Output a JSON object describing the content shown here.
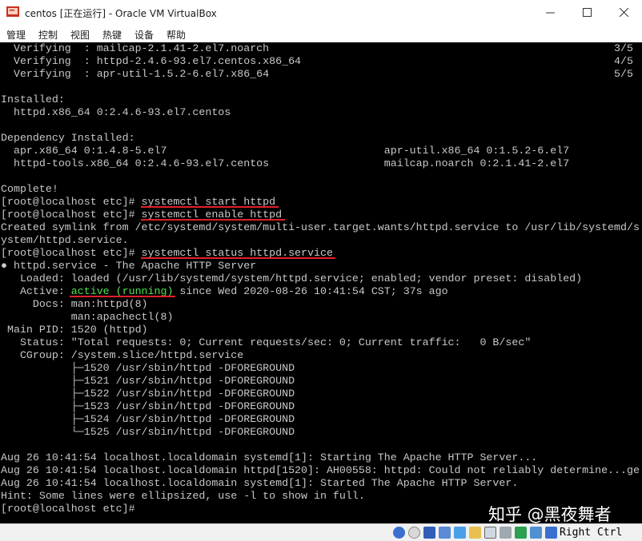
{
  "window": {
    "title": "centos [正在运行] - Oracle VM VirtualBox",
    "minimize_glyph": "—",
    "maximize_glyph": "☐",
    "close_glyph": "✕"
  },
  "menu": [
    "管理",
    "控制",
    "视图",
    "热键",
    "设备",
    "帮助"
  ],
  "console": {
    "lines": [
      "  Verifying  : mailcap-2.1.41-2.el7.noarch",
      "  Verifying  : httpd-2.4.6-93.el7.centos.x86_64",
      "  Verifying  : apr-util-1.5.2-6.el7.x86_64",
      "",
      "Installed:",
      "  httpd.x86_64 0:2.4.6-93.el7.centos",
      "",
      "Dependency Installed:",
      "  apr.x86_64 0:1.4.8-5.el7                                  apr-util.x86_64 0:1.5.2-6.el7",
      "  httpd-tools.x86_64 0:2.4.6-93.el7.centos                  mailcap.noarch 0:2.1.41-2.el7",
      "",
      "Complete!",
      "[root@localhost etc]# systemctl start httpd",
      "[root@localhost etc]# systemctl enable httpd",
      "Created symlink from /etc/systemd/system/multi-user.target.wants/httpd.service to /usr/lib/systemd/s",
      "ystem/httpd.service.",
      "[root@localhost etc]# systemctl status httpd.service",
      "● httpd.service - The Apache HTTP Server",
      "   Loaded: loaded (/usr/lib/systemd/system/httpd.service; enabled; vendor preset: disabled)",
      "   Active: ",
      "     Docs: man:httpd(8)",
      "           man:apachectl(8)",
      " Main PID: 1520 (httpd)",
      "   Status: \"Total requests: 0; Current requests/sec: 0; Current traffic:   0 B/sec\"",
      "   CGroup: /system.slice/httpd.service",
      "           ├─1520 /usr/sbin/httpd -DFOREGROUND",
      "           ├─1521 /usr/sbin/httpd -DFOREGROUND",
      "           ├─1522 /usr/sbin/httpd -DFOREGROUND",
      "           ├─1523 /usr/sbin/httpd -DFOREGROUND",
      "           ├─1524 /usr/sbin/httpd -DFOREGROUND",
      "           └─1525 /usr/sbin/httpd -DFOREGROUND",
      "",
      "Aug 26 10:41:54 localhost.localdomain systemd[1]: Starting The Apache HTTP Server...",
      "Aug 26 10:41:54 localhost.localdomain httpd[1520]: AH00558: httpd: Could not reliably determine...ge",
      "Aug 26 10:41:54 localhost.localdomain systemd[1]: Started The Apache HTTP Server.",
      "Hint: Some lines were ellipsized, use -l to show in full.",
      "[root@localhost etc]#"
    ],
    "active_state": "active (running)",
    "active_rest": " since Wed 2020-08-26 10:41:54 CST; 37s ago",
    "progress": [
      "3/5",
      "4/5",
      "5/5"
    ],
    "colors": {
      "background": "#000000",
      "text": "#c8c8c8",
      "underline": "#e0202a",
      "active": "#4ee24e"
    }
  },
  "watermark": "知乎 @黑夜舞者",
  "statusbar": {
    "host_key": "Right Ctrl",
    "icons": [
      "hard-disk-icon",
      "optical-drive-icon",
      "audio-icon",
      "network-icon",
      "usb-icon",
      "shared-folder-icon",
      "display-icon",
      "video-capture-icon",
      "processor-icon",
      "mouse-integration-icon",
      "keyboard-capture-icon"
    ]
  }
}
